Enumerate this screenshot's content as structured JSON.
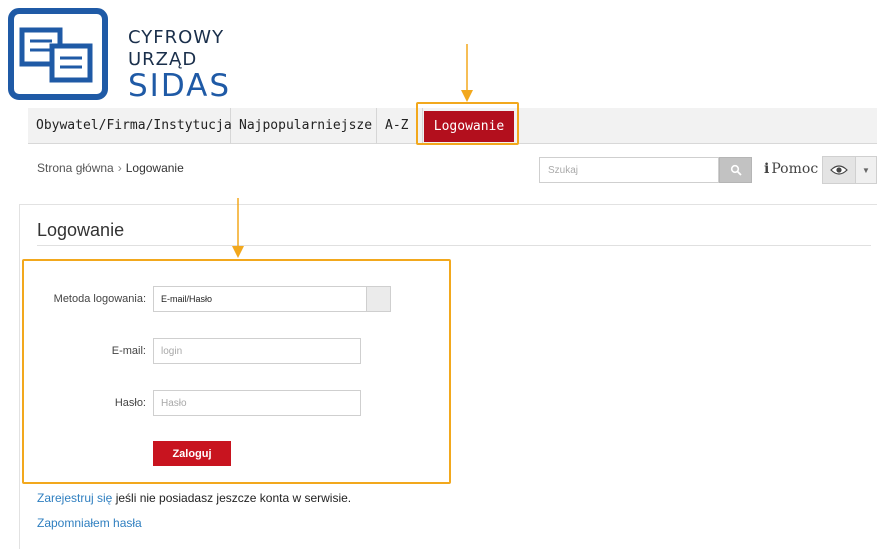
{
  "logo": {
    "line1": "CYFROWY",
    "line2": "URZĄD",
    "line3": "SIDAS",
    "icon": "document-stack-logo-icon"
  },
  "nav": {
    "items": [
      {
        "label": "Obywatel/Firma/Instytucja"
      },
      {
        "label": "Najpopularniejsze"
      },
      {
        "label": "A-Z"
      },
      {
        "label": "Logowanie"
      }
    ],
    "active_color": "#b30f1d"
  },
  "breadcrumb": {
    "home": "Strona główna",
    "separator": "›",
    "current": "Logowanie"
  },
  "search": {
    "placeholder": "Szukaj",
    "icon": "search-icon"
  },
  "help": {
    "icon_glyph": "i",
    "label": "Pomoc"
  },
  "accessibility": {
    "icon": "eye-icon",
    "caret": "▼"
  },
  "page": {
    "title": "Logowanie"
  },
  "form": {
    "method_label": "Metoda logowania:",
    "method_value": "E-mail/Hasło",
    "email_label": "E-mail:",
    "email_placeholder": "login",
    "password_label": "Hasło:",
    "password_placeholder": "Hasło",
    "submit_label": "Zaloguj"
  },
  "footer_links": {
    "register_link": "Zarejestruj się",
    "register_text": " jeśli nie posiadasz jeszcze konta w serwisie.",
    "forgot": "Zapomniałem hasła"
  },
  "colors": {
    "highlight": "#f2a81d",
    "brand_red": "#c8141f",
    "link_blue": "#2f7fc0",
    "logo_blue": "#1f5aa6"
  }
}
